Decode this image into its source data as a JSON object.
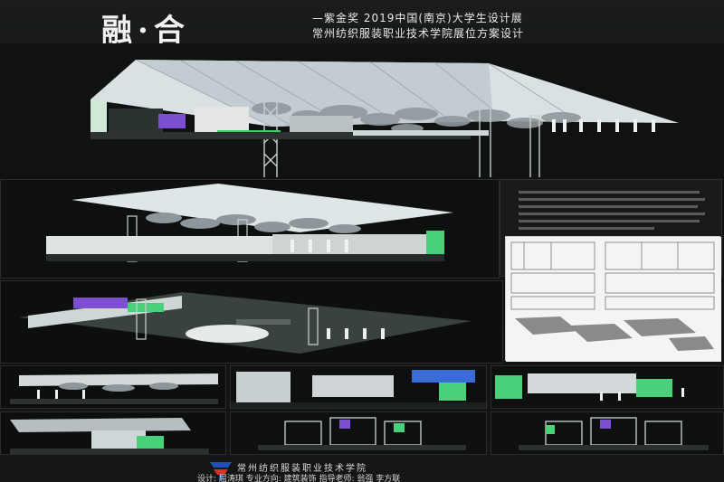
{
  "header": {
    "title": "融·合",
    "subtitle_line1": "—紫金奖 2019中国(南京)大学生设计展",
    "subtitle_line2": "常州纺织服装职业技术学院展位方案设计"
  },
  "footer": {
    "school_name": "常州纺织服装职业技术学院",
    "credits": "设计: 屈涛琪   专业方向: 建筑装饰   指导老师: 翁强 李方联"
  },
  "logo": {
    "icon": "school-logo-icon",
    "colors": [
      "#1f4fb8",
      "#d6312b"
    ]
  },
  "colors": {
    "background": "#0f1110",
    "canopy": "#e9eef0",
    "green_accent": "#3fcf6a",
    "purple_accent": "#7b4fd0"
  }
}
